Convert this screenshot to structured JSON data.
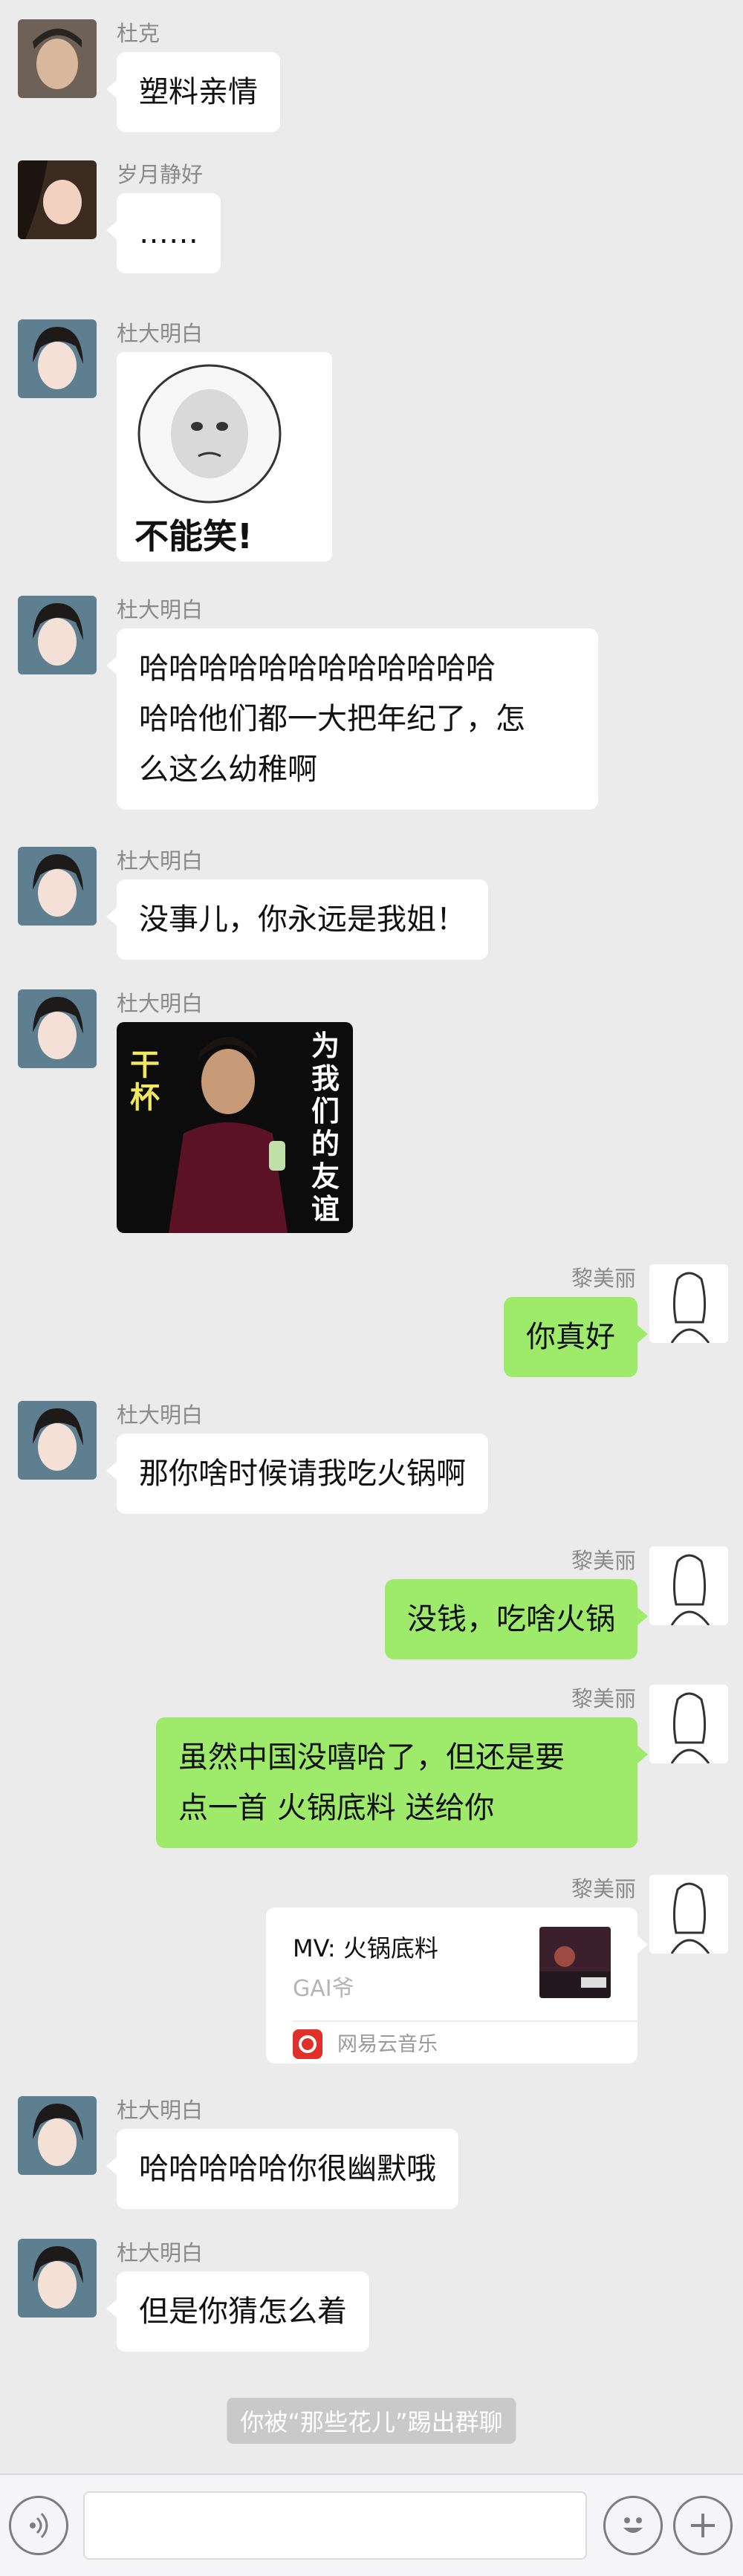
{
  "colors": {
    "background": "#ebebeb",
    "bubble_self": "#9eea6a",
    "bubble_other": "#ffffff",
    "system_tip": "#c9c9c9"
  },
  "messages": [
    {
      "sender": "杜克",
      "text": "塑料亲情"
    },
    {
      "sender": "岁月静好",
      "text": "……"
    },
    {
      "sender": "杜大明白",
      "sticker": "不能笑!"
    },
    {
      "sender": "杜大明白",
      "text": "哈哈哈哈哈哈哈哈哈哈哈哈\n哈哈他们都一大把年纪了，怎\n么这么幼稚啊"
    },
    {
      "sender": "杜大明白",
      "text": "没事儿，你永远是我姐！"
    },
    {
      "sender": "杜大明白",
      "sticker_left": "干杯",
      "sticker_right": "为我们的友谊"
    },
    {
      "sender": "黎美丽",
      "text": "你真好"
    },
    {
      "sender": "杜大明白",
      "text": "那你啥时候请我吃火锅啊"
    },
    {
      "sender": "黎美丽",
      "text": "没钱，吃啥火锅"
    },
    {
      "sender": "黎美丽",
      "text": "虽然中国没嘻哈了，但还是要\n点一首 火锅底料 送给你"
    },
    {
      "sender": "黎美丽",
      "music": {
        "title": "MV: 火锅底料",
        "artist": "GAI爷",
        "source": "网易云音乐"
      }
    },
    {
      "sender": "杜大明白",
      "text": "哈哈哈哈哈你很幽默哦"
    },
    {
      "sender": "杜大明白",
      "text": "但是你猜怎么着"
    }
  ],
  "system_tip": "你被“那些花儿”踢出群聊",
  "input_bar": {
    "voice_icon": "voice-icon",
    "emoji_icon": "emoji-icon",
    "plus_icon": "plus-icon"
  }
}
